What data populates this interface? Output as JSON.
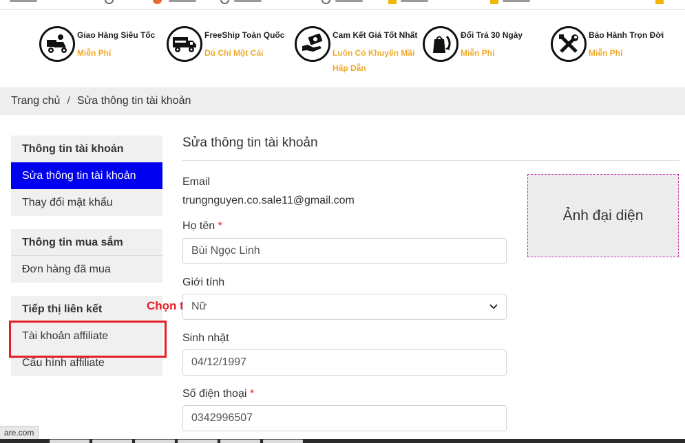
{
  "features": [
    {
      "title": "Giao Hàng Siêu Tốc",
      "subtitle": "Miễn Phí",
      "icon": "delivery-scooter-icon"
    },
    {
      "title": "FreeShip Toàn Quốc",
      "subtitle": "Dù Chỉ Một Cái",
      "icon": "delivery-truck-icon"
    },
    {
      "title": "Cam Kết Giá Tốt Nhất",
      "subtitle": "Luôn Có Khuyến Mãi Hấp Dẫn",
      "icon": "money-hand-icon"
    },
    {
      "title": "Đổi Trả 30 Ngày",
      "subtitle": "Miễn Phí",
      "icon": "return-bag-icon"
    },
    {
      "title": "Bảo Hành Trọn Đời",
      "subtitle": "Miễn Phí",
      "icon": "tools-icon"
    }
  ],
  "breadcrumb": {
    "home": "Trang chủ",
    "separator": "/",
    "current": "Sửa thông tin tài khoản"
  },
  "sidebar": {
    "groups": [
      {
        "title": "Thông tin tài khoản",
        "items": [
          "Sửa thông tin tài khoản",
          "Thay đổi mật khẩu"
        ]
      },
      {
        "title": "Thông tin mua sắm",
        "items": [
          "Đơn hàng đã mua"
        ]
      },
      {
        "title": "Tiếp thị liên kết",
        "items": [
          "Tài khoản affiliate",
          "Cấu hình affiliate"
        ]
      }
    ],
    "active_item": "Sửa thông tin tài khoản"
  },
  "annotation": {
    "text": "Chọn tài khoản affiliate",
    "color": "#e31e24"
  },
  "form": {
    "title": "Sửa thông tin tài khoản",
    "email_label": "Email",
    "email_value": "trungnguyen.co.sale11@gmail.com",
    "name_label": "Họ tên",
    "name_value": "Bùi Ngọc Linh",
    "gender_label": "Giới tính",
    "gender_value": "Nữ",
    "birthday_label": "Sinh nhật",
    "birthday_value": "04/12/1997",
    "phone_label": "Số điện thoại",
    "phone_value": "0342996507",
    "required_mark": "*"
  },
  "avatar": {
    "label": "Ảnh đại diện"
  },
  "status_bar": {
    "text": "are.com"
  },
  "colors": {
    "accent_blue": "#0000f0",
    "subtitle_orange": "#f0a92a",
    "required_red": "#e31e24"
  }
}
